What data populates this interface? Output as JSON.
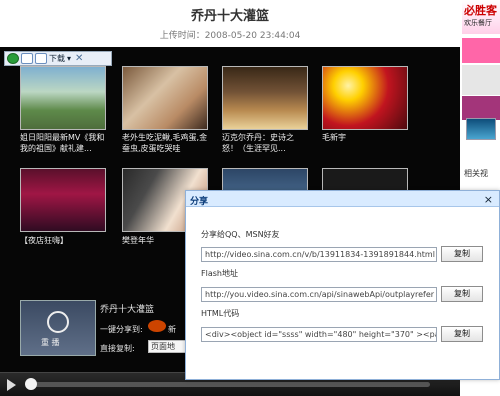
{
  "page": {
    "title": "乔丹十大灌篮",
    "upload_time": "上传时间：2008-05-20 23:44:04"
  },
  "floatbar": {
    "download_label": "下载"
  },
  "thumbnails": [
    {
      "caption": "姐日阳阳最新MV《我和我的祖国》献礼建...",
      "style": "sun"
    },
    {
      "caption": "老外生吃泥鳅,毛鸡蛋,金蚕虫,皮蛋吃哭哇",
      "style": "eat"
    },
    {
      "caption": "迈克尔乔丹：史诗之怒！（生涯罕见...",
      "style": "bball"
    },
    {
      "caption": "毛新宇",
      "style": "rally"
    },
    {
      "caption": "【夜店狂嗨】",
      "style": "stage"
    },
    {
      "caption": "樊登年华",
      "style": "girl"
    },
    {
      "caption": "",
      "style": "blue"
    },
    {
      "caption": "",
      "style": "film"
    }
  ],
  "info": {
    "video_name": "乔丹十大灌篮",
    "replay_label": "重 播",
    "share_label": "一键分享到:",
    "weibo_label": "新",
    "direct_copy_label": "直接复制:",
    "page_address": "页面地"
  },
  "right_col": {
    "ad_big": "必胜客",
    "ad_small": "欢乐餐厅",
    "related": "相关视"
  },
  "share_modal": {
    "title": "分享",
    "share_qq_label": "分享给QQ、MSN好友",
    "share_qq_value": "http://video.sina.com.cn/v/b/13911834-1391891844.html",
    "flash_label": "Flash地址",
    "flash_value": "http://you.video.sina.com.cn/api/sinawebApi/outplayrefer",
    "html_label": "HTML代码",
    "html_value": "<div><object id=\"ssss\" width=\"480\" height=\"370\" ><pa",
    "copy_label": "复制"
  }
}
